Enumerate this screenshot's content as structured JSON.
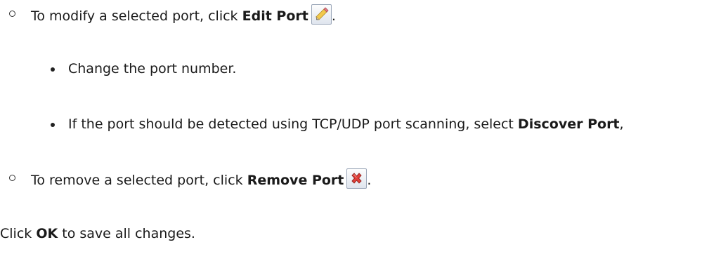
{
  "items": {
    "edit_port": {
      "prefix": "To modify a selected port, click ",
      "bold": "Edit Port",
      "suffix": ".",
      "icon": "pencil-icon"
    },
    "change_port": {
      "text": "Change the port number."
    },
    "discover_port": {
      "prefix": "If the port should be detected using TCP/UDP port scanning, select ",
      "bold": "Discover Port",
      "suffix": ","
    },
    "remove_port": {
      "prefix": "To remove a selected port, click ",
      "bold": "Remove Port",
      "suffix": ".",
      "icon": "red-x-icon"
    },
    "click_ok": {
      "prefix": "Click ",
      "bold": "OK",
      "suffix": " to save all changes."
    }
  }
}
